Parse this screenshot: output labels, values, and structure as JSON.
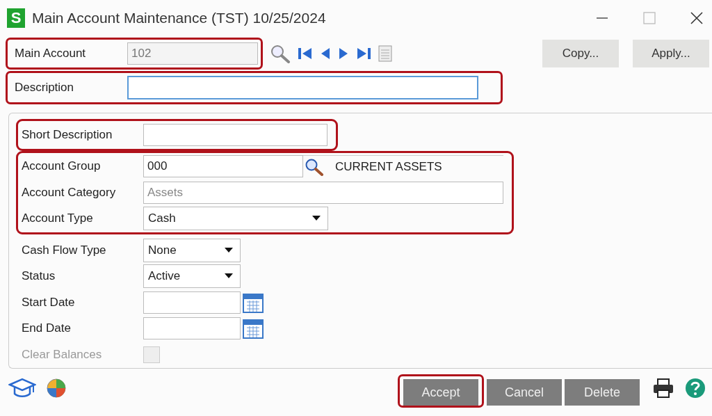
{
  "window": {
    "logo": "S",
    "title": "Main Account Maintenance (TST) 10/25/2024"
  },
  "main_account": {
    "label": "Main Account",
    "value": "102",
    "highlighted": true
  },
  "description": {
    "label": "Description",
    "focused": true,
    "highlighted": true
  },
  "header_buttons": [
    "Copy...",
    "Apply..."
  ],
  "groups": [
    {
      "highlighted": true,
      "rows": [
        {
          "kind": "text",
          "label": "Short Description"
        }
      ]
    },
    {
      "highlighted": true,
      "rows": [
        {
          "kind": "lookup",
          "label": "Account Group",
          "value": "000",
          "lookup_text": "CURRENT ASSETS"
        },
        {
          "kind": "readonly",
          "label": "Account Category",
          "value": "Assets"
        },
        {
          "kind": "wide-select",
          "label": "Account Type",
          "value": "Cash"
        }
      ]
    },
    {
      "highlighted": false,
      "rows": [
        {
          "kind": "select",
          "label": "Cash Flow Type",
          "value": "None"
        },
        {
          "kind": "select",
          "label": "Status",
          "value": "Active"
        },
        {
          "kind": "date",
          "label": "Start Date"
        },
        {
          "kind": "date",
          "label": "End Date"
        },
        {
          "kind": "checkbox",
          "label": "Clear Balances",
          "disabled": true,
          "checked": false
        }
      ]
    }
  ],
  "footer_buttons": [
    {
      "label": "Accept",
      "highlighted": true
    },
    {
      "label": "Cancel",
      "highlighted": false
    },
    {
      "label": "Delete",
      "highlighted": false
    }
  ]
}
